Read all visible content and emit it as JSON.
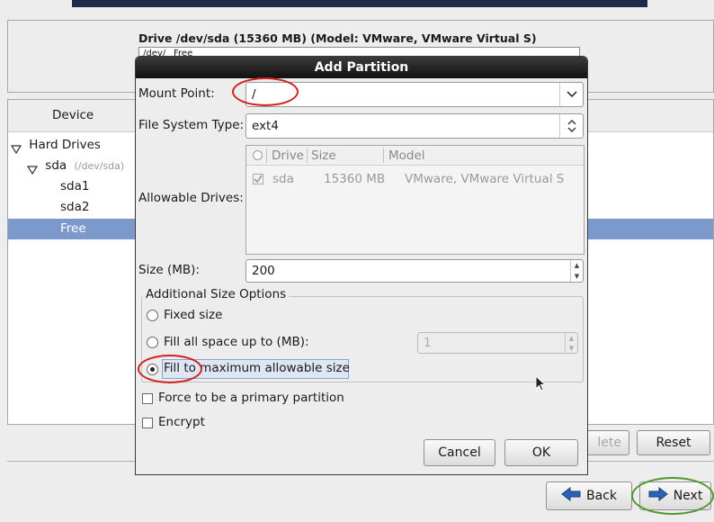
{
  "installer": {
    "drive_title": "Drive /dev/sda (15360 MB) (Model: VMware, VMware Virtual S)",
    "drive_bar": [
      "/dev/",
      "Free"
    ],
    "device_column": "Device",
    "tree": {
      "hard_drives": "Hard Drives",
      "sda": "sda",
      "sda_path": "(/dev/sda)",
      "sda1": "sda1",
      "sda2": "sda2",
      "free": "Free"
    },
    "buttons": {
      "delete": "lete",
      "reset": "Reset",
      "back": "Back",
      "next": "Next"
    }
  },
  "dialog": {
    "title": "Add Partition",
    "mount_point_label": "Mount Point:",
    "mount_point_value": "/",
    "fs_type_label": "File System Type:",
    "fs_type_value": "ext4",
    "allowable_drives_label": "Allowable Drives:",
    "drive_table": {
      "columns": [
        "Drive",
        "Size",
        "Model"
      ],
      "rows": [
        {
          "drive": "sda",
          "size": "15360 MB",
          "model": "VMware, VMware Virtual S",
          "checked": true
        }
      ]
    },
    "size_label": "Size (MB):",
    "size_value": "200",
    "additional_size_options": "Additional Size Options",
    "options": {
      "fixed": "Fixed size",
      "fill_up_to": "Fill all space up to (MB):",
      "fill_up_to_value": "1",
      "fill_max": "Fill to maximum allowable size",
      "selected": "fill_max"
    },
    "force_primary": "Force to be a primary partition",
    "encrypt": "Encrypt",
    "cancel": "Cancel",
    "ok": "OK"
  },
  "colors": {
    "selection": "#7b9acb",
    "titlebar": "#1a1a1a",
    "annotation_red": "#d21f1f",
    "annotation_green": "#4f9a2f",
    "arrow_blue": "#2a63b8"
  }
}
